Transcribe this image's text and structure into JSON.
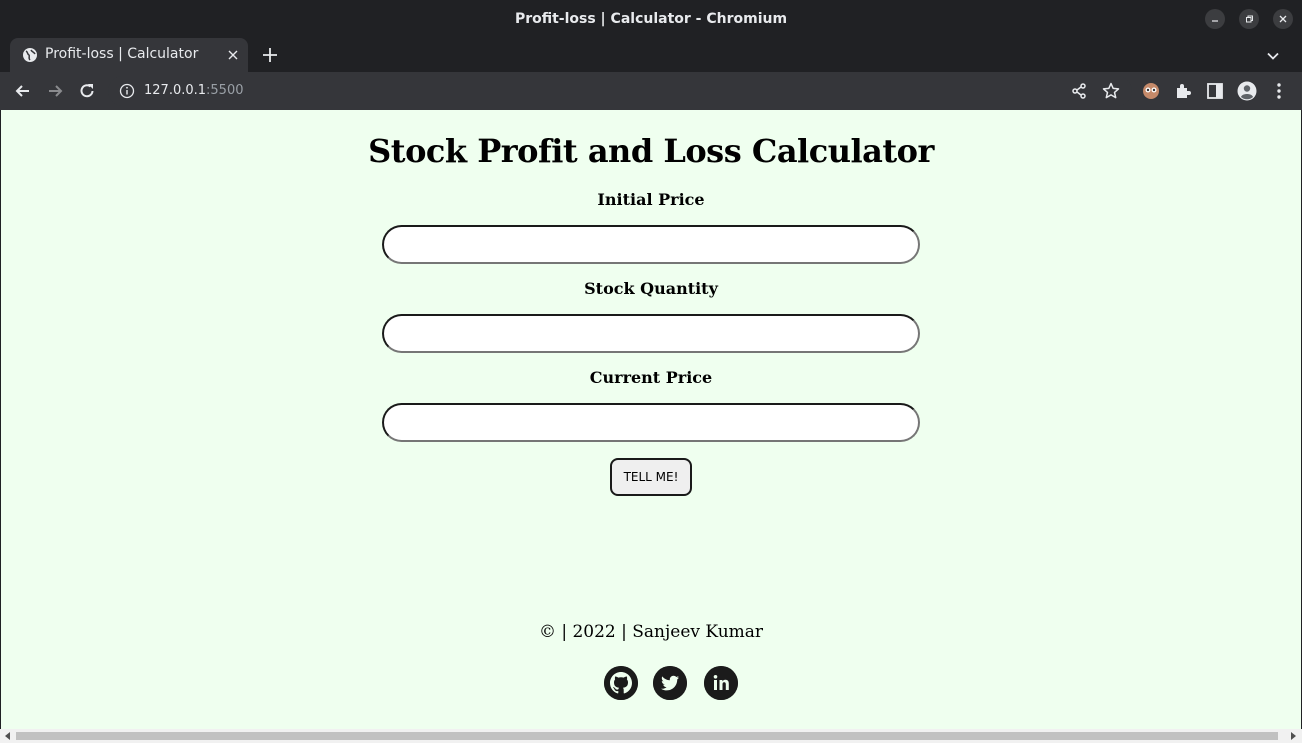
{
  "window": {
    "title": "Profit-loss | Calculator - Chromium"
  },
  "tab": {
    "title": "Profit-loss | Calculator"
  },
  "address_bar": {
    "host": "127.0.0.1",
    "port": ":5500"
  },
  "page": {
    "heading": "Stock Profit and Loss Calculator",
    "fields": [
      {
        "label": "Initial Price",
        "value": ""
      },
      {
        "label": "Stock Quantity",
        "value": ""
      },
      {
        "label": "Current Price",
        "value": ""
      }
    ],
    "submit_label": "TELL ME!",
    "footer": "© | 2022 | Sanjeev Kumar",
    "social_links": [
      "github-icon",
      "twitter-icon",
      "linkedin-icon"
    ]
  },
  "colors": {
    "page_background": "#efffef",
    "browser_frame": "#202124",
    "toolbar": "#35363a"
  }
}
